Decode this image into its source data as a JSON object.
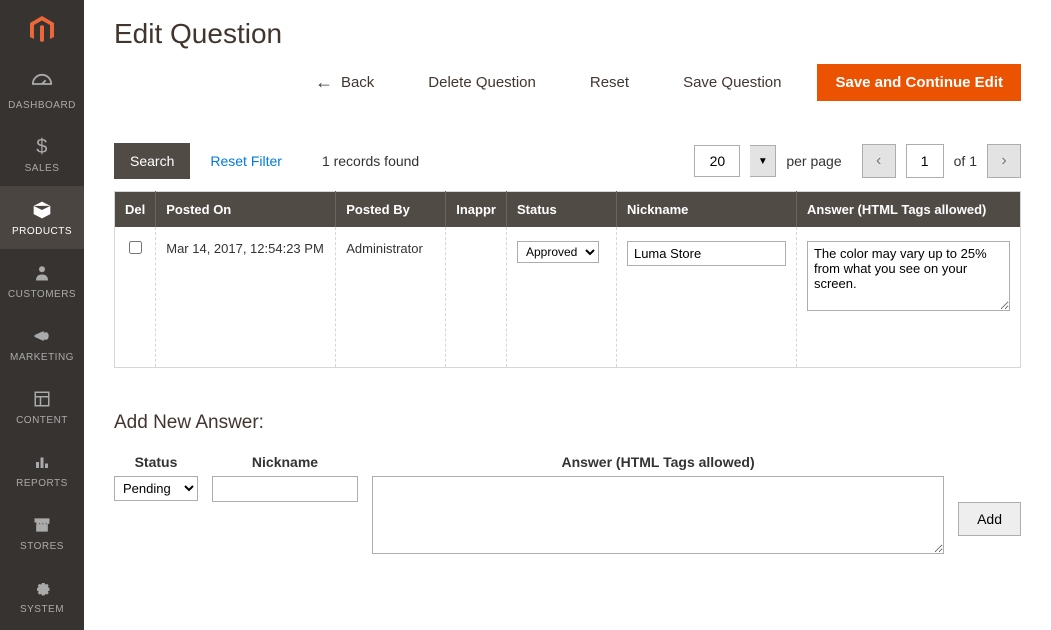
{
  "sidebar": {
    "items": [
      {
        "label": "DASHBOARD"
      },
      {
        "label": "SALES"
      },
      {
        "label": "PRODUCTS"
      },
      {
        "label": "CUSTOMERS"
      },
      {
        "label": "MARKETING"
      },
      {
        "label": "CONTENT"
      },
      {
        "label": "REPORTS"
      },
      {
        "label": "STORES"
      },
      {
        "label": "SYSTEM"
      }
    ]
  },
  "page": {
    "title": "Edit Question"
  },
  "actions": {
    "back": "Back",
    "delete": "Delete Question",
    "reset": "Reset",
    "save": "Save Question",
    "save_continue": "Save and Continue Edit"
  },
  "toolbar": {
    "search": "Search",
    "reset_filter": "Reset Filter",
    "records_found": "1 records found",
    "per_page_value": "20",
    "per_page_label": "per page",
    "page_current": "1",
    "page_of": "of 1"
  },
  "table": {
    "headers": {
      "del": "Del",
      "posted_on": "Posted On",
      "posted_by": "Posted By",
      "inappr": "Inappr",
      "status": "Status",
      "nickname": "Nickname",
      "answer": "Answer (HTML Tags allowed)"
    },
    "row": {
      "posted_on": "Mar 14, 2017, 12:54:23 PM",
      "posted_by": "Administrator",
      "inappr": "",
      "status_selected": "Approved",
      "nickname": "Luma Store",
      "answer": "The color may vary up to 25% from what you see on your screen."
    }
  },
  "add_answer": {
    "section_title": "Add New Answer:",
    "labels": {
      "status": "Status",
      "nickname": "Nickname",
      "answer": "Answer (HTML Tags allowed)"
    },
    "status_selected": "Pending",
    "nickname_value": "",
    "answer_value": "",
    "add_button": "Add"
  }
}
